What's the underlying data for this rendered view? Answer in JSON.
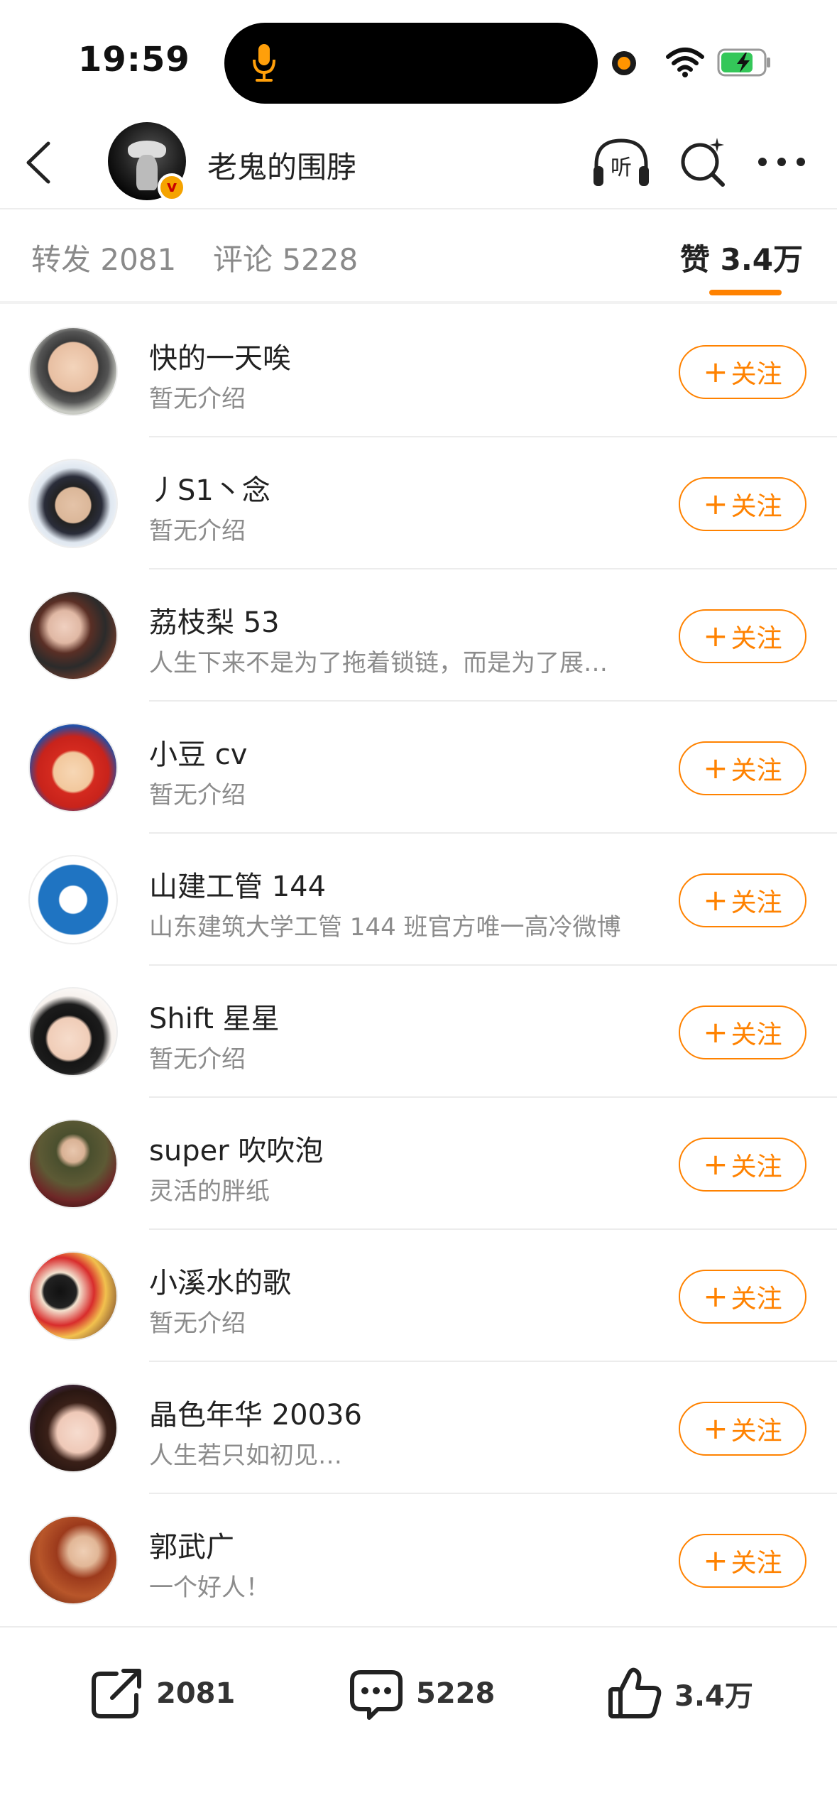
{
  "status_bar": {
    "time": "19:59"
  },
  "header": {
    "title": "老鬼的围脖"
  },
  "tabs": {
    "repost": "转发 2081",
    "comment": "评论 5228",
    "like": "赞 3.4万"
  },
  "follow_label": "关注",
  "users": [
    {
      "name": "快的一天唉",
      "bio": "暂无介绍"
    },
    {
      "name": "丿S1丶念",
      "bio": "暂无介绍"
    },
    {
      "name": "荔枝梨 53",
      "bio": "人生下来不是为了拖着锁链，而是为了展…"
    },
    {
      "name": "小豆 cv",
      "bio": "暂无介绍"
    },
    {
      "name": "山建工管 144",
      "bio": "山东建筑大学工管 144 班官方唯一高冷微博"
    },
    {
      "name": "Shift 星星",
      "bio": "暂无介绍"
    },
    {
      "name": "super 吹吹泡",
      "bio": "灵活的胖纸"
    },
    {
      "name": "小溪水的歌",
      "bio": "暂无介绍"
    },
    {
      "name": "晶色年华 20036",
      "bio": "人生若只如初见…"
    },
    {
      "name": "郭武广",
      "bio": "一个好人！"
    }
  ],
  "bottom_bar": {
    "repost_count": "2081",
    "comment_count": "5228",
    "like_count": "3.4万"
  },
  "colors": {
    "accent": "#ff8200",
    "text_primary": "#222222",
    "text_secondary": "#8c8c8c"
  },
  "icons": [
    "back-icon",
    "listen-icon",
    "search-icon",
    "more-icon",
    "repost-icon",
    "comment-icon",
    "like-icon",
    "mic-icon",
    "wifi-icon",
    "battery-icon"
  ]
}
